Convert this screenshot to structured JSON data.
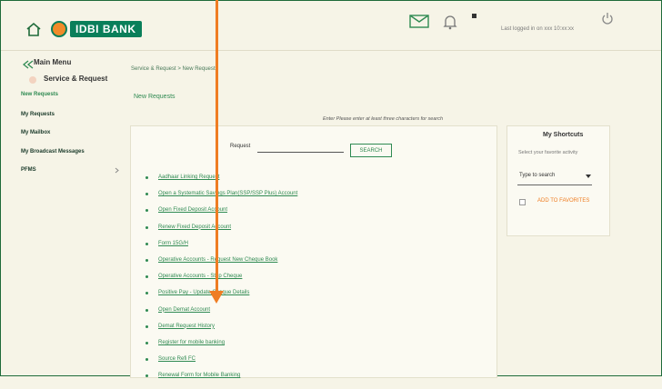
{
  "header": {
    "bank_name": "IDBI BANK",
    "user_text": "Last logged in on xxx 10:xx:xx"
  },
  "sidebar": {
    "title": "Main Menu",
    "section": "Service & Request",
    "items": [
      {
        "label": "New Requests",
        "active": true
      },
      {
        "label": "My Requests",
        "active": false
      },
      {
        "label": "My Mailbox",
        "active": false
      },
      {
        "label": "My Broadcast Messages",
        "active": false
      },
      {
        "label": "PFMS",
        "active": false
      }
    ]
  },
  "main": {
    "breadcrumb": "Service & Request > New Requests",
    "title": "New Requests",
    "hint": "Enter Please enter at least three characters for search",
    "request_label": "Request",
    "search_button": "SEARCH",
    "requests": [
      "Aadhaar Linking Request",
      "Open a Systematic Savings Plan(SSP/SSP Plus) Account",
      "Open Fixed Deposit Account",
      "Renew Fixed Deposit Account",
      "Form 15G/H",
      "Operative Accounts - Request New Cheque Book",
      "Operative Accounts - Stop Cheque",
      "Positive Pay - Update Cheque Details",
      "Open Demat Account",
      "Demat Request History",
      "Register for mobile banking",
      "Source Refi FC",
      "Renewal Form for Mobile Banking"
    ]
  },
  "shortcuts": {
    "title": "My Shortcuts",
    "subtitle": "Select your favorite activity",
    "select_value": "Type to search",
    "add_fav": "ADD TO FAVORITES"
  },
  "colors": {
    "accent": "#2f8a52",
    "arrow": "#ef7d23",
    "border": "#1f6b3a"
  }
}
